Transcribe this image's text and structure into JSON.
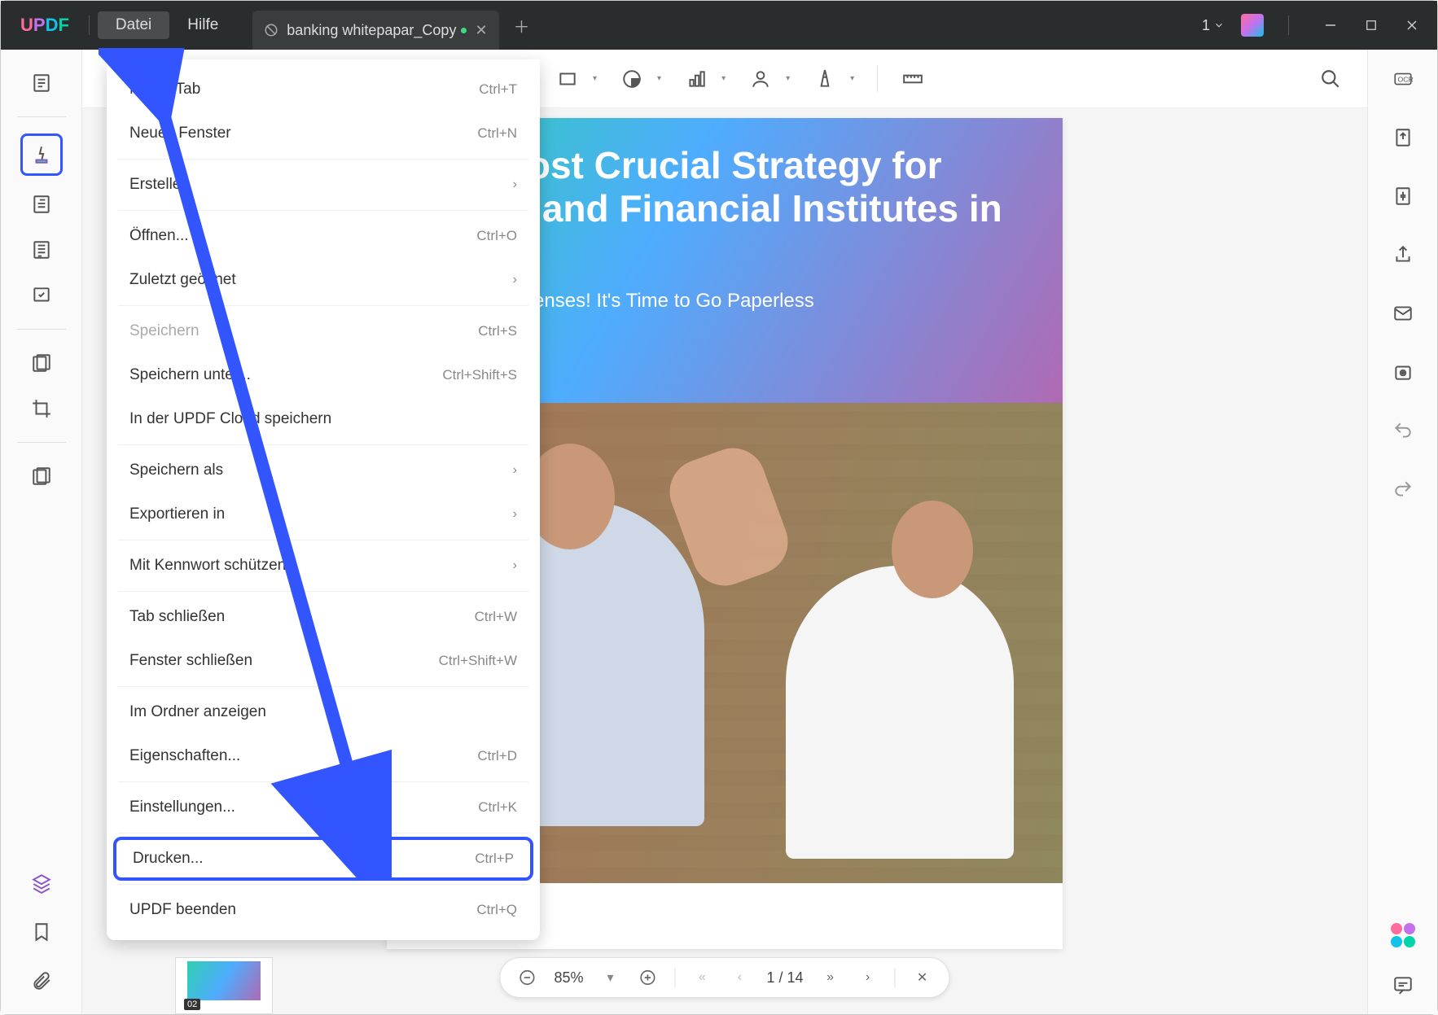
{
  "titlebar": {
    "logo": {
      "u": "U",
      "p": "P",
      "d": "D",
      "f": "F"
    },
    "menus": [
      "Datei",
      "Hilfe"
    ],
    "active_menu": 0,
    "tab": {
      "name": "banking whitepapar_Copy"
    },
    "tab_count": "1"
  },
  "dropdown": {
    "groups": [
      [
        {
          "label": "Neuer Tab",
          "shortcut": "Ctrl+T"
        },
        {
          "label": "Neues Fenster",
          "shortcut": "Ctrl+N"
        }
      ],
      [
        {
          "label": "Erstellen",
          "submenu": true
        }
      ],
      [
        {
          "label": "Öffnen...",
          "shortcut": "Ctrl+O"
        },
        {
          "label": "Zuletzt geöffnet",
          "submenu": true
        }
      ],
      [
        {
          "label": "Speichern",
          "shortcut": "Ctrl+S",
          "disabled": true
        },
        {
          "label": "Speichern unter...",
          "shortcut": "Ctrl+Shift+S"
        },
        {
          "label": "In der UPDF Cloud speichern"
        }
      ],
      [
        {
          "label": "Speichern als",
          "submenu": true
        },
        {
          "label": "Exportieren in",
          "submenu": true
        }
      ],
      [
        {
          "label": "Mit Kennwort schützen",
          "submenu": true
        }
      ],
      [
        {
          "label": "Tab schließen",
          "shortcut": "Ctrl+W"
        },
        {
          "label": "Fenster schließen",
          "shortcut": "Ctrl+Shift+W"
        }
      ],
      [
        {
          "label": "Im Ordner anzeigen"
        },
        {
          "label": "Eigenschaften...",
          "shortcut": "Ctrl+D"
        }
      ],
      [
        {
          "label": "Einstellungen...",
          "shortcut": "Ctrl+K"
        }
      ],
      [
        {
          "label": "Drucken...",
          "shortcut": "Ctrl+P",
          "boxed": true
        }
      ],
      [
        {
          "label": "UPDF beenden",
          "shortcut": "Ctrl+Q"
        }
      ]
    ]
  },
  "document": {
    "title": "The Most Crucial Strategy for Banks and Financial Institutes in 2022",
    "subtitle": "No More Expenses! It's Time to Go Paperless"
  },
  "page_controls": {
    "zoom": "85%",
    "page_current": "1",
    "page_sep": "/",
    "page_total": "14"
  },
  "thumb": {
    "num": "02"
  }
}
